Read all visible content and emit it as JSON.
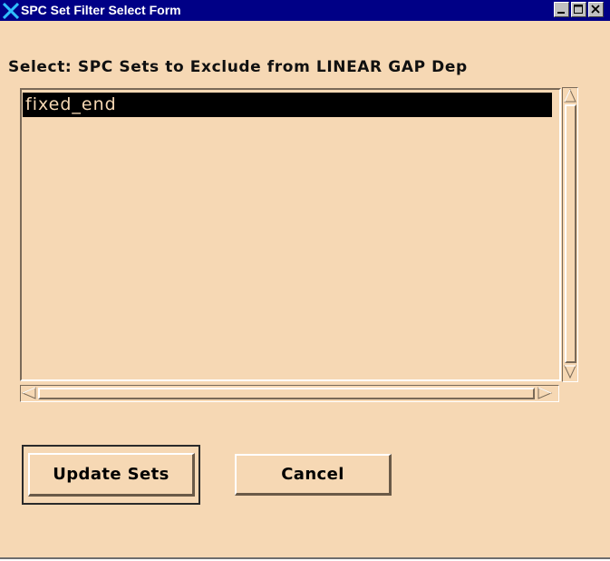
{
  "window": {
    "title": "SPC Set Filter Select Form",
    "app_icon": "x-logo-icon",
    "controls": [
      "minimize-icon",
      "maximize-icon",
      "close-icon"
    ]
  },
  "form": {
    "prompt": "Select: SPC Sets to Exclude from LINEAR GAP Dep",
    "list": {
      "items": [
        {
          "label": "fixed_end",
          "selected": true
        }
      ]
    },
    "buttons": {
      "update_label": "Update Sets",
      "cancel_label": "Cancel"
    }
  },
  "colors": {
    "background": "#f6d8b4",
    "titlebar": "#000086",
    "selection": "#000000"
  }
}
